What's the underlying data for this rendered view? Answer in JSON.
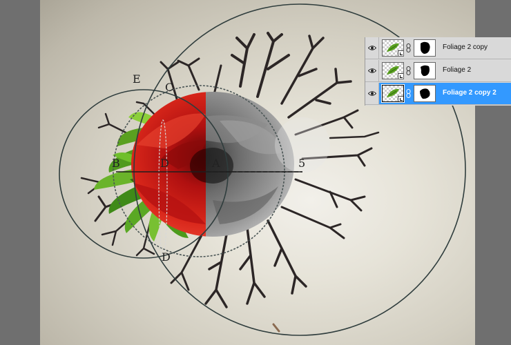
{
  "canvas": {
    "letters": [
      "E",
      "C",
      "B",
      "D",
      "A",
      "5",
      "D"
    ],
    "colors": {
      "rose": "#c81810",
      "rose_grey": "#7a7a7a",
      "foliage": "#5aa020",
      "branches": "#2c2626",
      "circle_stroke": "#2f3d3d"
    }
  },
  "layers_panel": {
    "layers": [
      {
        "name": "Foliage 2 copy",
        "visible": true,
        "selected": false,
        "icon": "eye-icon"
      },
      {
        "name": "Foliage 2",
        "visible": true,
        "selected": false,
        "icon": "eye-icon"
      },
      {
        "name": "Foliage 2 copy 2",
        "visible": true,
        "selected": true,
        "icon": "eye-icon"
      }
    ],
    "colors": {
      "panel_bg": "#d9d9d9",
      "selection": "#3399ff"
    }
  }
}
